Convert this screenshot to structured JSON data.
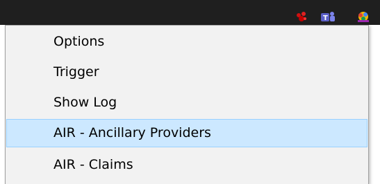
{
  "menu": {
    "items": [
      {
        "label": "Options"
      },
      {
        "label": "Trigger"
      },
      {
        "label": "Show Log"
      },
      {
        "label": "AIR - Ancillary Providers",
        "highlighted": true
      },
      {
        "label": "AIR - Claims"
      }
    ]
  },
  "tray": {
    "icons": [
      "red-shield-icon",
      "teams-icon",
      "colorful-app-icon"
    ]
  },
  "colors": {
    "taskbar": "#1f1f1f",
    "menu_background": "#f2f2f2",
    "highlight_background": "#cce8ff",
    "highlight_border": "#99d1ff"
  }
}
